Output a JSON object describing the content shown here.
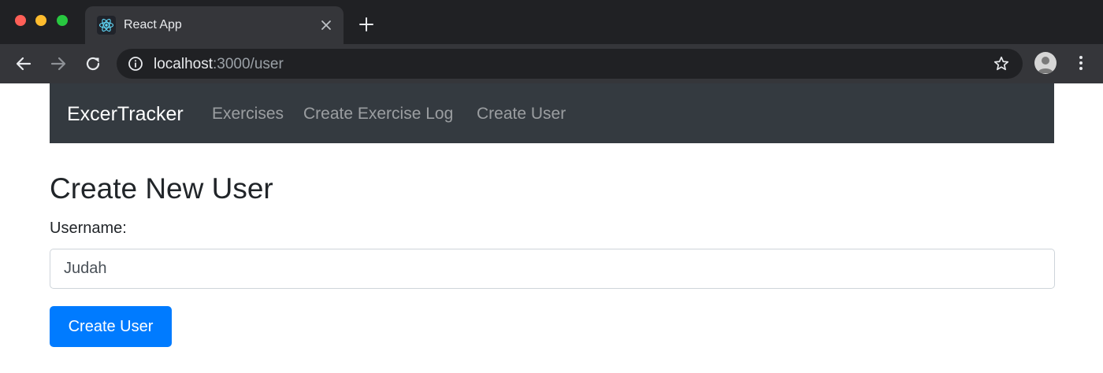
{
  "browser": {
    "tab": {
      "title": "React App",
      "favicon_icon": "react-logo-icon"
    },
    "toolbar": {
      "url_host": "localhost",
      "url_path": ":3000/user",
      "icons": [
        "back-arrow-icon",
        "forward-arrow-icon",
        "reload-icon",
        "info-icon",
        "star-icon",
        "profile-avatar-icon",
        "kebab-menu-icon"
      ]
    }
  },
  "navbar": {
    "brand": "ExcerTracker",
    "links": [
      {
        "label": "Exercises"
      },
      {
        "label": "Create Exercise Log"
      },
      {
        "label": "Create User"
      }
    ]
  },
  "form": {
    "title": "Create New User",
    "username_label": "Username:",
    "username_value": "Judah",
    "submit_label": "Create User"
  },
  "colors": {
    "navbar_bg": "#343a40",
    "primary": "#007bff",
    "browser_dark": "#202124",
    "browser_toolbar": "#35363a"
  }
}
